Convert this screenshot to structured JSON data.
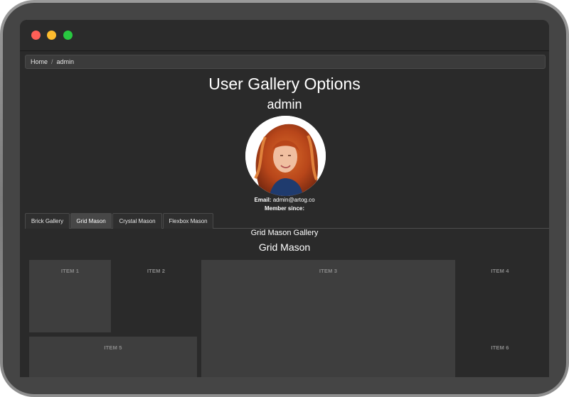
{
  "breadcrumb": {
    "home": "Home",
    "separator": "/",
    "current": "admin"
  },
  "page": {
    "title": "User Gallery Options",
    "username": "admin"
  },
  "profile": {
    "email_label": "Email:",
    "email_value": "admin@artog.co",
    "member_label": "Member since:",
    "member_value": ""
  },
  "tabs": [
    {
      "label": "Brick Gallery",
      "active": false
    },
    {
      "label": "Grid Mason",
      "active": true
    },
    {
      "label": "Crystal Mason",
      "active": false
    },
    {
      "label": "Flexbox Mason",
      "active": false
    }
  ],
  "gallery": {
    "label": "Grid Mason Gallery",
    "title": "Grid Mason",
    "items": [
      "ITEM 1",
      "ITEM 2",
      "ITEM 3",
      "ITEM 4",
      "ITEM 5",
      "ITEM 6"
    ]
  },
  "colors": {
    "close": "#fe5f57",
    "minimize": "#febc2e",
    "maximize": "#28c840",
    "background": "#2a2a2a",
    "tile": "#3e3e3e"
  }
}
